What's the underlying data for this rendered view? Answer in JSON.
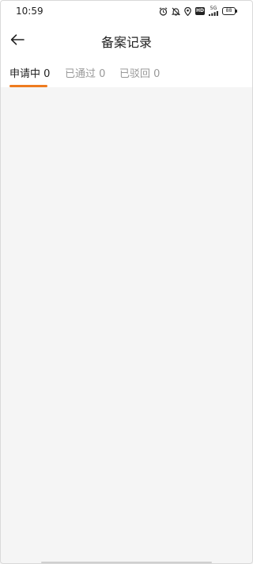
{
  "status_bar": {
    "time": "10:59",
    "network_label": "5G",
    "battery_level": "88",
    "icons": [
      "alarm-icon",
      "mute-icon",
      "location-icon",
      "hd-icon",
      "signal-icon",
      "battery-icon"
    ]
  },
  "header": {
    "title": "备案记录",
    "back_icon": "arrow-left-icon"
  },
  "tabs": [
    {
      "label": "申请中 0",
      "active": true
    },
    {
      "label": "已通过 0",
      "active": false
    },
    {
      "label": "已驳回 0",
      "active": false
    }
  ],
  "colors": {
    "accent": "#ee7b1f",
    "tab_active": "#222222",
    "tab_inactive": "#999999",
    "content_background": "#f5f5f5"
  }
}
